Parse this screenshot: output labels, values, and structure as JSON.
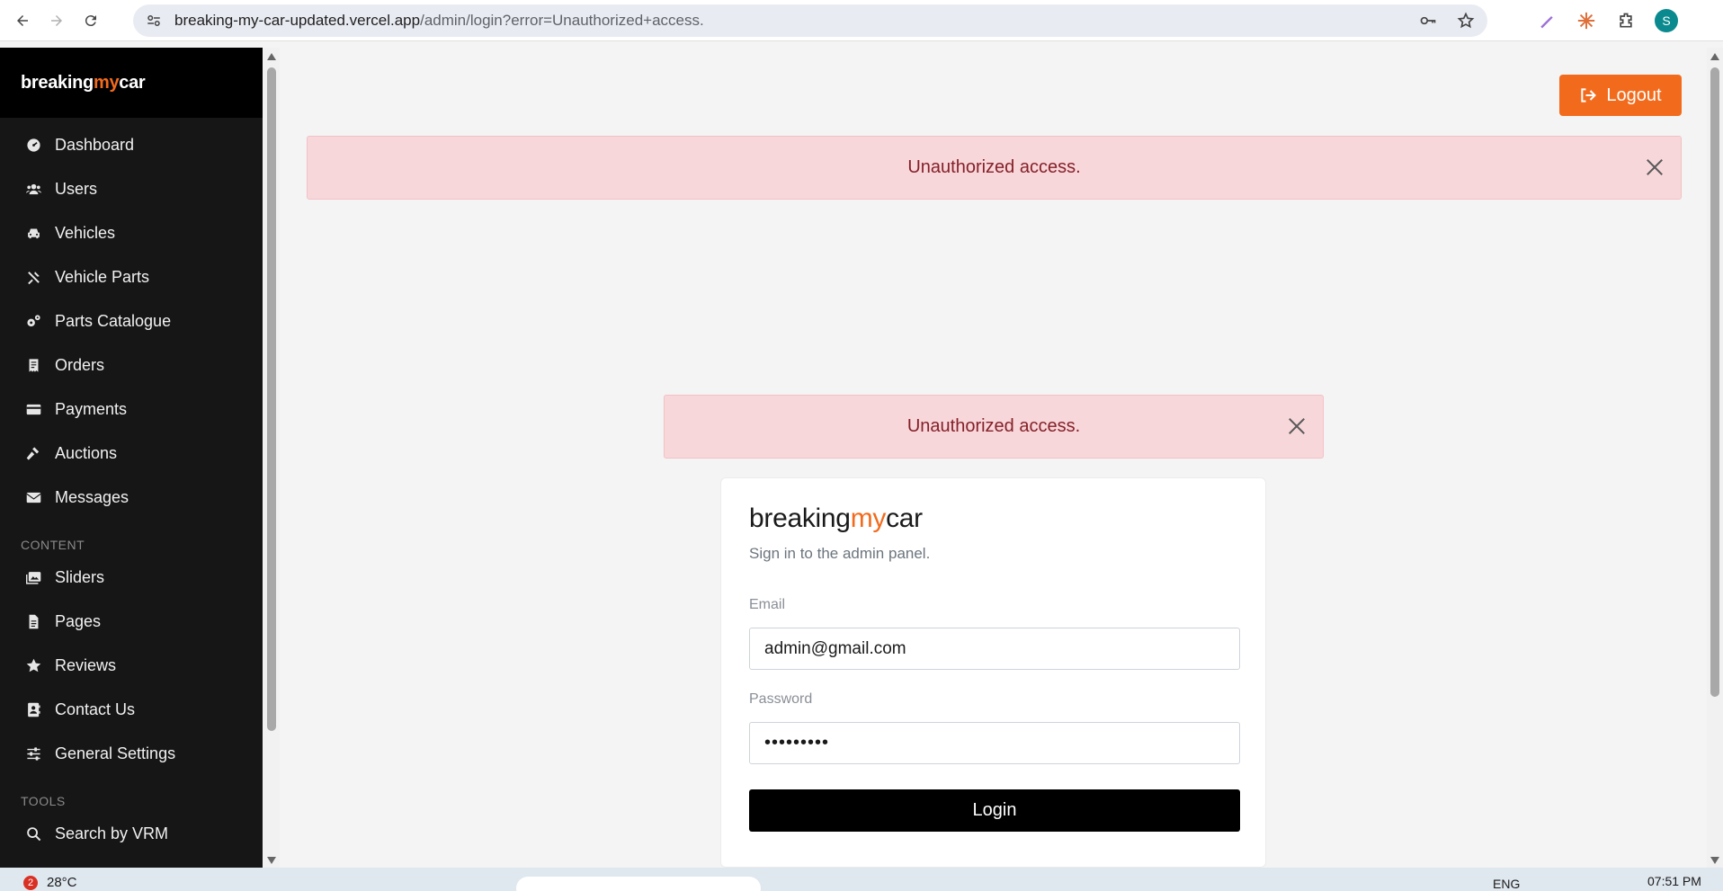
{
  "browser": {
    "url_host": "breaking-my-car-updated.vercel.app",
    "url_path": "/admin/login?error=Unauthorized+access.",
    "profile_initial": "S"
  },
  "sidebar": {
    "brand_prefix": "breaking",
    "brand_my": "my",
    "brand_suffix": "car",
    "items": [
      {
        "label": "Dashboard",
        "icon": "dashboard-icon"
      },
      {
        "label": "Users",
        "icon": "users-icon"
      },
      {
        "label": "Vehicles",
        "icon": "car-icon"
      },
      {
        "label": "Vehicle Parts",
        "icon": "tools-icon"
      },
      {
        "label": "Parts Catalogue",
        "icon": "gears-icon"
      },
      {
        "label": "Orders",
        "icon": "receipt-icon"
      },
      {
        "label": "Payments",
        "icon": "credit-card-icon"
      },
      {
        "label": "Auctions",
        "icon": "gavel-icon"
      },
      {
        "label": "Messages",
        "icon": "envelope-icon"
      }
    ],
    "content_section": "CONTENT",
    "content_items": [
      {
        "label": "Sliders",
        "icon": "images-icon"
      },
      {
        "label": "Pages",
        "icon": "file-icon"
      },
      {
        "label": "Reviews",
        "icon": "star-icon"
      },
      {
        "label": "Contact Us",
        "icon": "address-book-icon"
      },
      {
        "label": "General Settings",
        "icon": "sliders-icon"
      }
    ],
    "tools_section": "TOOLS",
    "tools_items": [
      {
        "label": "Search by VRM",
        "icon": "search-icon"
      }
    ]
  },
  "header": {
    "logout_label": "Logout"
  },
  "alerts": {
    "top_message": "Unauthorized access.",
    "login_message": "Unauthorized access."
  },
  "login": {
    "brand_prefix": "breaking",
    "brand_my": "my",
    "brand_suffix": "car",
    "subtitle": "Sign in to the admin panel.",
    "email_label": "Email",
    "email_value": "admin@gmail.com",
    "password_label": "Password",
    "password_value": "•••••••••",
    "submit_label": "Login"
  },
  "taskbar": {
    "weather_badge": "2",
    "temperature": "28°C",
    "language": "ENG",
    "time": "07:51 PM"
  },
  "colors": {
    "accent": "#f26b1d",
    "sidebar_bg": "#161616",
    "alert_bg": "#f8d7da",
    "alert_text": "#842029"
  }
}
